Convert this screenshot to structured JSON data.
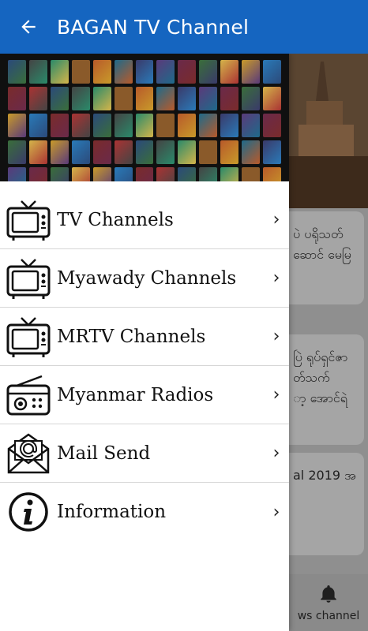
{
  "appbar": {
    "title": "BAGAN TV Channel"
  },
  "menu": {
    "items": [
      {
        "label": "TV Channels",
        "icon": "tv-icon"
      },
      {
        "label": "Myawady Channels",
        "icon": "tv-icon"
      },
      {
        "label": "MRTV Channels",
        "icon": "tv-icon"
      },
      {
        "label": "Myanmar Radios",
        "icon": "radio-icon"
      },
      {
        "label": "Mail Send",
        "icon": "mail-icon"
      },
      {
        "label": "Information",
        "icon": "info-icon"
      }
    ],
    "chevron": "›"
  },
  "background": {
    "cards": [
      {
        "lines": [
          "ပဲ ပရိုသတ်",
          "ဆောင် မေမြ"
        ]
      },
      {
        "lines": [
          "ပြဲ ရုပ်ရှင်ဇာ",
          "တ်သက်",
          "ာ့ အောင်ရဲ"
        ]
      },
      {
        "lines": [
          "al 2019 အ"
        ]
      }
    ],
    "bottom_nav_label": "ws channel"
  },
  "colors": {
    "appbar": "#1565c0",
    "drawer": "#ffffff"
  }
}
